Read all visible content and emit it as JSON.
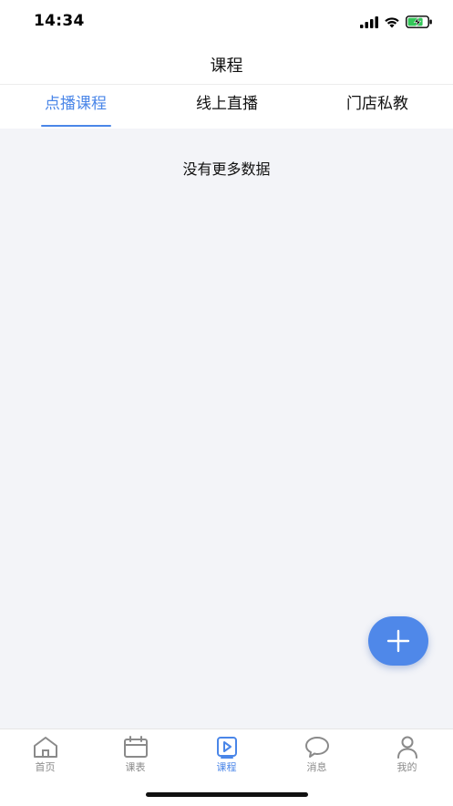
{
  "status_bar": {
    "time": "14:34"
  },
  "header": {
    "title": "课程"
  },
  "tabs": [
    {
      "label": "点播课程",
      "active": true
    },
    {
      "label": "线上直播",
      "active": false
    },
    {
      "label": "门店私教",
      "active": false
    }
  ],
  "content": {
    "empty_message": "没有更多数据"
  },
  "fab": {
    "icon": "plus-icon"
  },
  "tabbar": [
    {
      "label": "首页",
      "icon": "home-icon",
      "active": false
    },
    {
      "label": "课表",
      "icon": "calendar-icon",
      "active": false
    },
    {
      "label": "课程",
      "icon": "play-icon",
      "active": true
    },
    {
      "label": "消息",
      "icon": "chat-bubble-icon",
      "active": false
    },
    {
      "label": "我的",
      "icon": "user-icon",
      "active": false
    }
  ],
  "colors": {
    "accent": "#4a86e8",
    "background": "#f3f4f8",
    "inactive": "#8a8a8a",
    "battery_fill": "#33c759"
  }
}
